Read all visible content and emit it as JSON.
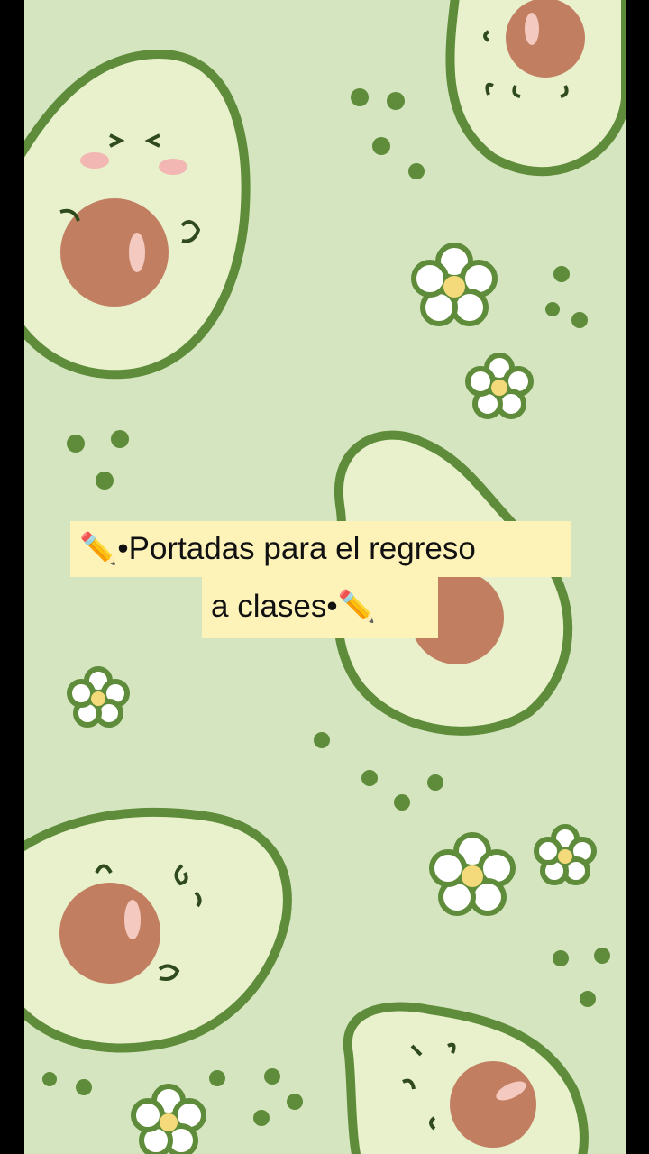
{
  "caption": {
    "line1_prefix_icon": "✏️",
    "line1_text": "•Portadas para el regreso",
    "line2_text": "a clases•",
    "line2_suffix_icon": "✏️"
  },
  "colors": {
    "background": "#d5e5bf",
    "avocado_outer": "#5e8c3a",
    "avocado_flesh": "#e5efcb",
    "pit": "#bf7a5a",
    "caption_bg": "#fdf2b8"
  }
}
